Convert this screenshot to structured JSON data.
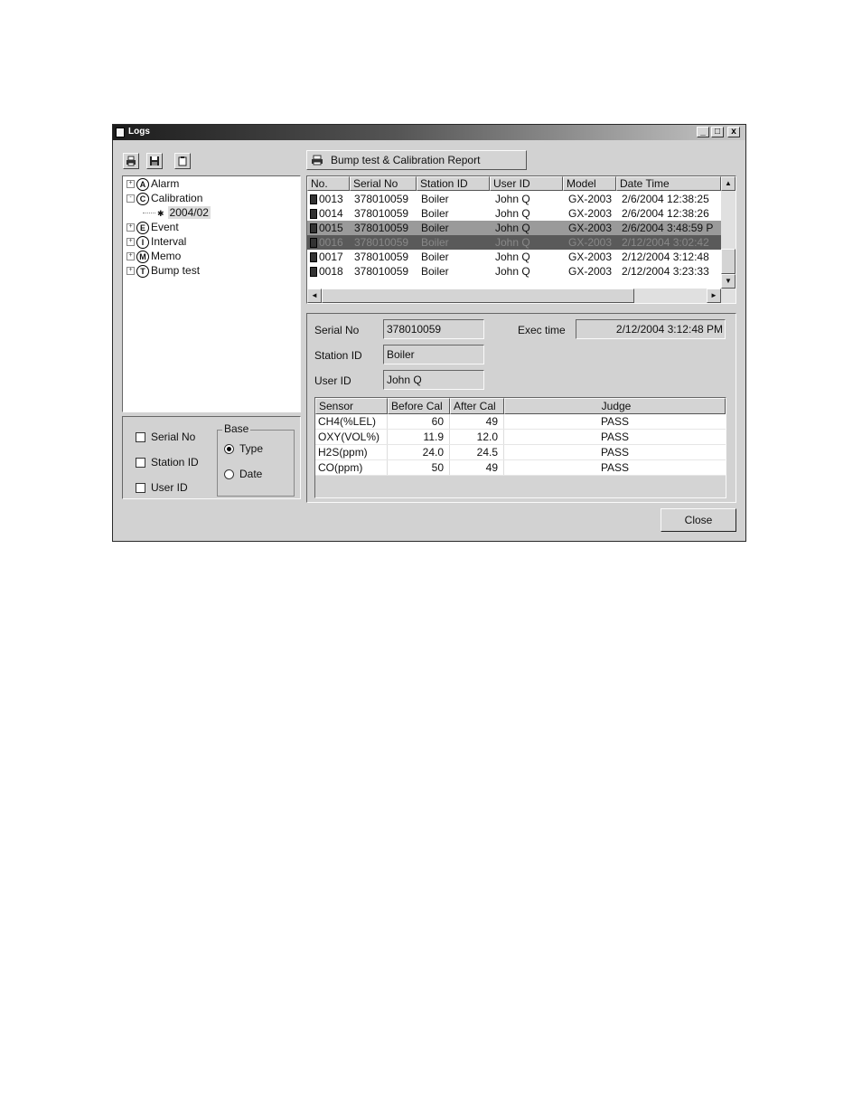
{
  "window": {
    "title": "Logs",
    "minimize": "_",
    "maximize": "□",
    "close": "x"
  },
  "toolbar": {
    "print_icon": "printer-icon",
    "save_icon": "floppy-icon",
    "clipboard_icon": "clipboard-icon"
  },
  "tree": {
    "items": [
      {
        "letter": "A",
        "label": "Alarm",
        "expander": "+"
      },
      {
        "letter": "C",
        "label": "Calibration",
        "expander": "-"
      },
      {
        "label": "2004/02"
      },
      {
        "letter": "E",
        "label": "Event",
        "expander": "+"
      },
      {
        "letter": "I",
        "label": "Interval",
        "expander": "+"
      },
      {
        "letter": "M",
        "label": "Memo",
        "expander": "+"
      },
      {
        "letter": "T",
        "label": "Bump test",
        "expander": "+"
      }
    ]
  },
  "filter": {
    "serial_no": "Serial No",
    "station_id": "Station ID",
    "user_id": "User ID",
    "base_legend": "Base",
    "type": "Type",
    "date": "Date",
    "selected_base": "Type"
  },
  "report_button": "Bump test & Calibration Report",
  "grid": {
    "headers": [
      "No.",
      "Serial No",
      "Station ID",
      "User ID",
      "Model",
      "Date Time"
    ],
    "rows": [
      [
        "0013",
        "378010059",
        "Boiler",
        "John Q",
        "GX-2003",
        "2/6/2004 12:38:25"
      ],
      [
        "0014",
        "378010059",
        "Boiler",
        "John Q",
        "GX-2003",
        "2/6/2004 12:38:26"
      ],
      [
        "0015",
        "378010059",
        "Boiler",
        "John Q",
        "GX-2003",
        "2/6/2004 3:48:59 P"
      ],
      [
        "0016",
        "378010059",
        "Boiler",
        "John Q",
        "GX-2003",
        "2/12/2004 3:02:42"
      ],
      [
        "0017",
        "378010059",
        "Boiler",
        "John Q",
        "GX-2003",
        "2/12/2004 3:12:48"
      ],
      [
        "0018",
        "378010059",
        "Boiler",
        "John Q",
        "GX-2003",
        "2/12/2004 3:23:33"
      ]
    ]
  },
  "detail": {
    "serial_label": "Serial No",
    "serial_value": "378010059",
    "station_label": "Station ID",
    "station_value": "Boiler",
    "user_label": "User ID",
    "user_value": "John Q",
    "exec_label": "Exec time",
    "exec_value": "2/12/2004 3:12:48 PM"
  },
  "sensor_table": {
    "headers": [
      "Sensor",
      "Before Cal",
      "After Cal",
      "Judge"
    ],
    "rows": [
      [
        "CH4(%LEL)",
        "60",
        "49",
        "PASS"
      ],
      [
        "OXY(VOL%)",
        "11.9",
        "12.0",
        "PASS"
      ],
      [
        "H2S(ppm)",
        "24.0",
        "24.5",
        "PASS"
      ],
      [
        "CO(ppm)",
        "50",
        "49",
        "PASS"
      ]
    ]
  },
  "close_button": "Close"
}
